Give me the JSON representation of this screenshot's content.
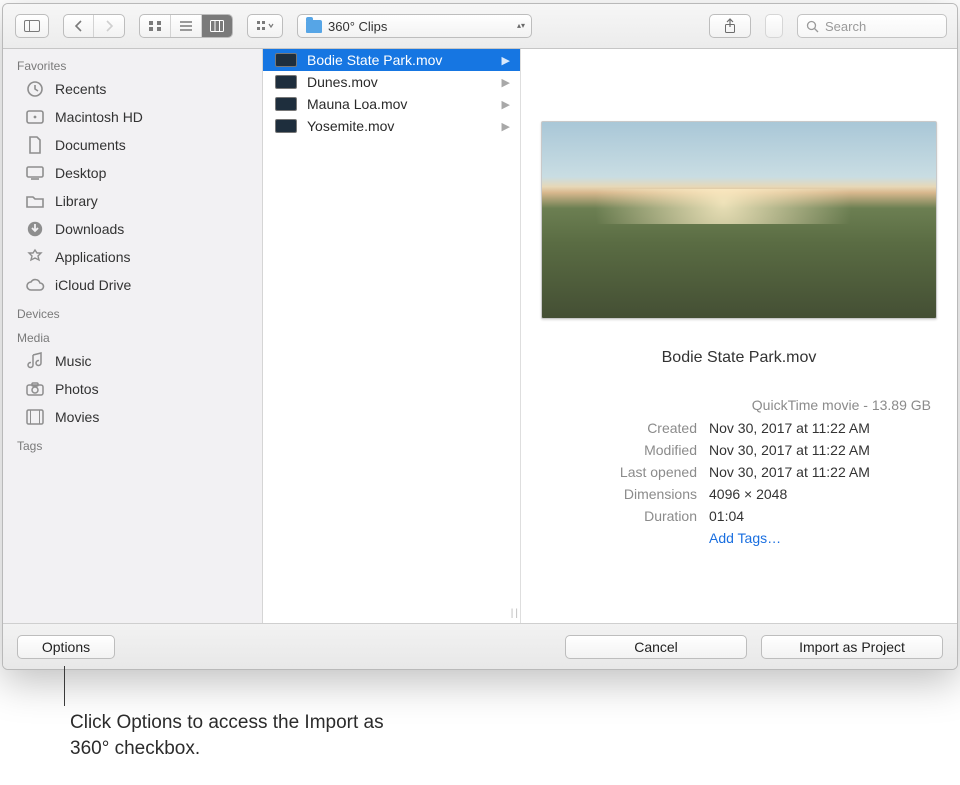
{
  "toolbar": {
    "path_folder": "360° Clips",
    "search_placeholder": "Search"
  },
  "sidebar": {
    "sections": [
      {
        "title": "Favorites",
        "items": [
          "Recents",
          "Macintosh HD",
          "Documents",
          "Desktop",
          "Library",
          "Downloads",
          "Applications",
          "iCloud Drive"
        ]
      },
      {
        "title": "Devices",
        "items": []
      },
      {
        "title": "Media",
        "items": [
          "Music",
          "Photos",
          "Movies"
        ]
      },
      {
        "title": "Tags",
        "items": []
      }
    ]
  },
  "files": [
    {
      "name": "Bodie State Park.mov",
      "selected": true
    },
    {
      "name": "Dunes.mov",
      "selected": false
    },
    {
      "name": "Mauna Loa.mov",
      "selected": false
    },
    {
      "name": "Yosemite.mov",
      "selected": false
    }
  ],
  "preview": {
    "title": "Bodie State Park.mov",
    "type_line": "QuickTime movie - 13.89 GB",
    "meta": {
      "Created": "Nov 30, 2017 at 11:22 AM",
      "Modified": "Nov 30, 2017 at 11:22 AM",
      "Last opened": "Nov 30, 2017 at 11:22 AM",
      "Dimensions": "4096 × 2048",
      "Duration": "01:04"
    },
    "add_tags": "Add Tags…",
    "labels": {
      "created": "Created",
      "modified": "Modified",
      "last_opened": "Last opened",
      "dimensions": "Dimensions",
      "duration": "Duration"
    }
  },
  "footer": {
    "options": "Options",
    "cancel": "Cancel",
    "import": "Import as Project"
  },
  "annotation": "Click Options to access the Import as 360° checkbox."
}
